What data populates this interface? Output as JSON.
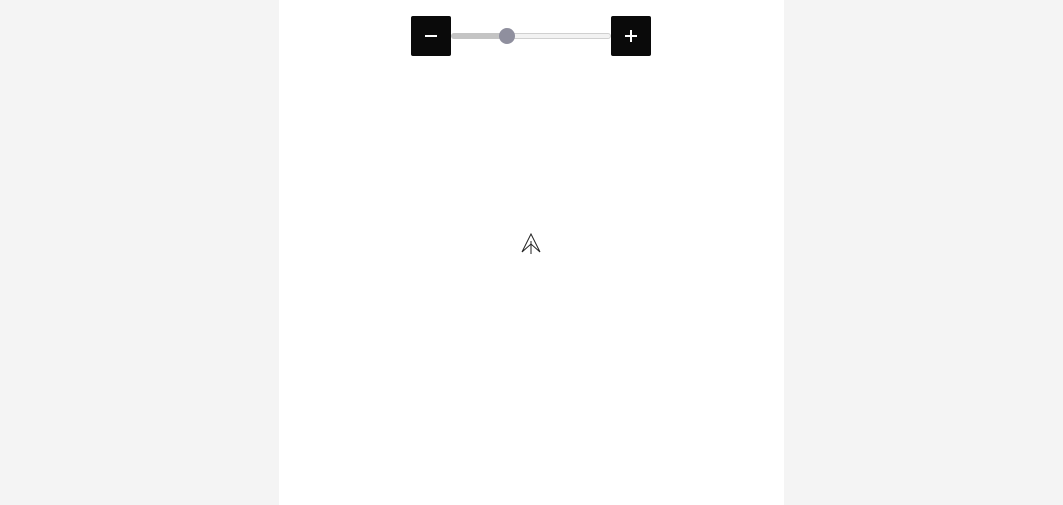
{
  "zoom": {
    "zoom_out_icon": "minus-icon",
    "zoom_in_icon": "plus-icon",
    "level": 0.35,
    "button_color": "#0a0a0a",
    "thumb_color": "#8f8f9e"
  },
  "map": {
    "center_marker_icon": "north-arrow-icon"
  }
}
